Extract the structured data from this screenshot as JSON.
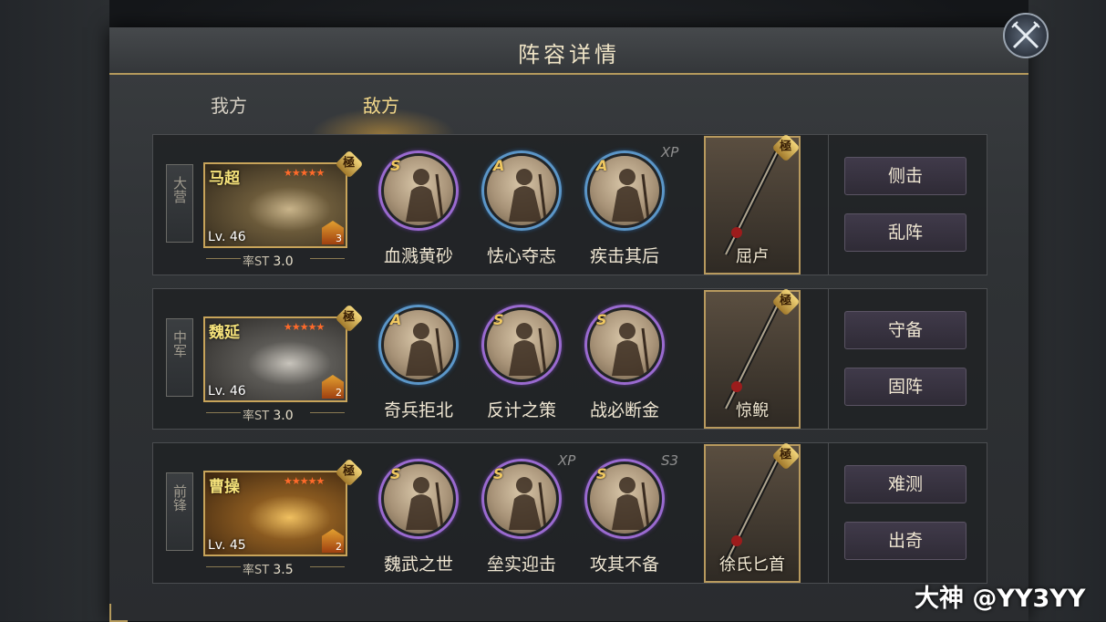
{
  "dialog": {
    "title": "阵容详情",
    "close_icon": "crossed-swords-close-icon"
  },
  "tabs": [
    {
      "label": "我方",
      "active": false
    },
    {
      "label": "敌方",
      "active": true
    }
  ],
  "rows": [
    {
      "position": "大营",
      "hero": {
        "name": "马超",
        "level": "Lv. 46",
        "rate_label": "率ST",
        "rate": "3.0",
        "badge": "3",
        "stars": "★★★★★",
        "quality": "極"
      },
      "skills": [
        {
          "grade": "S",
          "name": "血溅黄砂",
          "ring": "purple"
        },
        {
          "grade": "A",
          "name": "怯心夺志",
          "ring": "blue"
        },
        {
          "grade": "A",
          "name": "疾击其后",
          "ring": "blue",
          "tag": "XP"
        }
      ],
      "weapon": {
        "name": "屈卢",
        "quality": "極"
      },
      "formations": [
        "侧击",
        "乱阵"
      ]
    },
    {
      "position": "中军",
      "hero": {
        "name": "魏延",
        "level": "Lv. 46",
        "rate_label": "率ST",
        "rate": "3.0",
        "badge": "2",
        "stars": "★★★★★",
        "quality": "極"
      },
      "skills": [
        {
          "grade": "A",
          "name": "奇兵拒北",
          "ring": "blue"
        },
        {
          "grade": "S",
          "name": "反计之策",
          "ring": "purple"
        },
        {
          "grade": "S",
          "name": "战必断金",
          "ring": "purple"
        }
      ],
      "weapon": {
        "name": "惊鲵",
        "quality": "極"
      },
      "formations": [
        "守备",
        "固阵"
      ]
    },
    {
      "position": "前锋",
      "hero": {
        "name": "曹操",
        "level": "Lv. 45",
        "rate_label": "率ST",
        "rate": "3.5",
        "badge": "2",
        "stars": "★★★★★",
        "quality": "極"
      },
      "skills": [
        {
          "grade": "S",
          "name": "魏武之世",
          "ring": "purple"
        },
        {
          "grade": "S",
          "name": "垒实迎击",
          "ring": "purple",
          "tag": "XP"
        },
        {
          "grade": "S",
          "name": "攻其不备",
          "ring": "purple",
          "tag": "S3"
        }
      ],
      "weapon": {
        "name": "徐氏匕首",
        "quality": "極"
      },
      "formations": [
        "难测",
        "出奇"
      ]
    }
  ],
  "watermark": "大神 @YY3YY",
  "colors": {
    "accent_gold": "#b59a5c",
    "tab_active": "#f4d98a",
    "skill_purple": "#9a6ad0",
    "skill_blue": "#5b96c8"
  }
}
